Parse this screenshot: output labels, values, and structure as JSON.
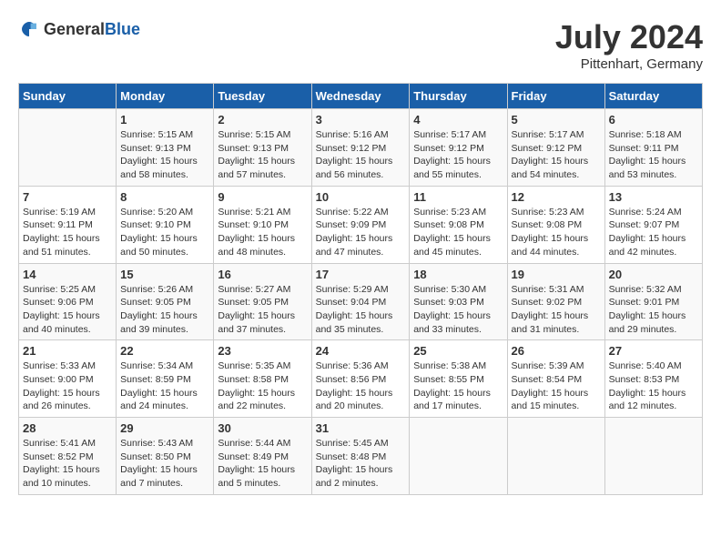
{
  "header": {
    "logo_general": "General",
    "logo_blue": "Blue",
    "month_year": "July 2024",
    "location": "Pittenhart, Germany"
  },
  "days_of_week": [
    "Sunday",
    "Monday",
    "Tuesday",
    "Wednesday",
    "Thursday",
    "Friday",
    "Saturday"
  ],
  "weeks": [
    [
      {
        "day": "",
        "sunrise": "",
        "sunset": "",
        "daylight": ""
      },
      {
        "day": "1",
        "sunrise": "Sunrise: 5:15 AM",
        "sunset": "Sunset: 9:13 PM",
        "daylight": "Daylight: 15 hours and 58 minutes."
      },
      {
        "day": "2",
        "sunrise": "Sunrise: 5:15 AM",
        "sunset": "Sunset: 9:13 PM",
        "daylight": "Daylight: 15 hours and 57 minutes."
      },
      {
        "day": "3",
        "sunrise": "Sunrise: 5:16 AM",
        "sunset": "Sunset: 9:12 PM",
        "daylight": "Daylight: 15 hours and 56 minutes."
      },
      {
        "day": "4",
        "sunrise": "Sunrise: 5:17 AM",
        "sunset": "Sunset: 9:12 PM",
        "daylight": "Daylight: 15 hours and 55 minutes."
      },
      {
        "day": "5",
        "sunrise": "Sunrise: 5:17 AM",
        "sunset": "Sunset: 9:12 PM",
        "daylight": "Daylight: 15 hours and 54 minutes."
      },
      {
        "day": "6",
        "sunrise": "Sunrise: 5:18 AM",
        "sunset": "Sunset: 9:11 PM",
        "daylight": "Daylight: 15 hours and 53 minutes."
      }
    ],
    [
      {
        "day": "7",
        "sunrise": "Sunrise: 5:19 AM",
        "sunset": "Sunset: 9:11 PM",
        "daylight": "Daylight: 15 hours and 51 minutes."
      },
      {
        "day": "8",
        "sunrise": "Sunrise: 5:20 AM",
        "sunset": "Sunset: 9:10 PM",
        "daylight": "Daylight: 15 hours and 50 minutes."
      },
      {
        "day": "9",
        "sunrise": "Sunrise: 5:21 AM",
        "sunset": "Sunset: 9:10 PM",
        "daylight": "Daylight: 15 hours and 48 minutes."
      },
      {
        "day": "10",
        "sunrise": "Sunrise: 5:22 AM",
        "sunset": "Sunset: 9:09 PM",
        "daylight": "Daylight: 15 hours and 47 minutes."
      },
      {
        "day": "11",
        "sunrise": "Sunrise: 5:23 AM",
        "sunset": "Sunset: 9:08 PM",
        "daylight": "Daylight: 15 hours and 45 minutes."
      },
      {
        "day": "12",
        "sunrise": "Sunrise: 5:23 AM",
        "sunset": "Sunset: 9:08 PM",
        "daylight": "Daylight: 15 hours and 44 minutes."
      },
      {
        "day": "13",
        "sunrise": "Sunrise: 5:24 AM",
        "sunset": "Sunset: 9:07 PM",
        "daylight": "Daylight: 15 hours and 42 minutes."
      }
    ],
    [
      {
        "day": "14",
        "sunrise": "Sunrise: 5:25 AM",
        "sunset": "Sunset: 9:06 PM",
        "daylight": "Daylight: 15 hours and 40 minutes."
      },
      {
        "day": "15",
        "sunrise": "Sunrise: 5:26 AM",
        "sunset": "Sunset: 9:05 PM",
        "daylight": "Daylight: 15 hours and 39 minutes."
      },
      {
        "day": "16",
        "sunrise": "Sunrise: 5:27 AM",
        "sunset": "Sunset: 9:05 PM",
        "daylight": "Daylight: 15 hours and 37 minutes."
      },
      {
        "day": "17",
        "sunrise": "Sunrise: 5:29 AM",
        "sunset": "Sunset: 9:04 PM",
        "daylight": "Daylight: 15 hours and 35 minutes."
      },
      {
        "day": "18",
        "sunrise": "Sunrise: 5:30 AM",
        "sunset": "Sunset: 9:03 PM",
        "daylight": "Daylight: 15 hours and 33 minutes."
      },
      {
        "day": "19",
        "sunrise": "Sunrise: 5:31 AM",
        "sunset": "Sunset: 9:02 PM",
        "daylight": "Daylight: 15 hours and 31 minutes."
      },
      {
        "day": "20",
        "sunrise": "Sunrise: 5:32 AM",
        "sunset": "Sunset: 9:01 PM",
        "daylight": "Daylight: 15 hours and 29 minutes."
      }
    ],
    [
      {
        "day": "21",
        "sunrise": "Sunrise: 5:33 AM",
        "sunset": "Sunset: 9:00 PM",
        "daylight": "Daylight: 15 hours and 26 minutes."
      },
      {
        "day": "22",
        "sunrise": "Sunrise: 5:34 AM",
        "sunset": "Sunset: 8:59 PM",
        "daylight": "Daylight: 15 hours and 24 minutes."
      },
      {
        "day": "23",
        "sunrise": "Sunrise: 5:35 AM",
        "sunset": "Sunset: 8:58 PM",
        "daylight": "Daylight: 15 hours and 22 minutes."
      },
      {
        "day": "24",
        "sunrise": "Sunrise: 5:36 AM",
        "sunset": "Sunset: 8:56 PM",
        "daylight": "Daylight: 15 hours and 20 minutes."
      },
      {
        "day": "25",
        "sunrise": "Sunrise: 5:38 AM",
        "sunset": "Sunset: 8:55 PM",
        "daylight": "Daylight: 15 hours and 17 minutes."
      },
      {
        "day": "26",
        "sunrise": "Sunrise: 5:39 AM",
        "sunset": "Sunset: 8:54 PM",
        "daylight": "Daylight: 15 hours and 15 minutes."
      },
      {
        "day": "27",
        "sunrise": "Sunrise: 5:40 AM",
        "sunset": "Sunset: 8:53 PM",
        "daylight": "Daylight: 15 hours and 12 minutes."
      }
    ],
    [
      {
        "day": "28",
        "sunrise": "Sunrise: 5:41 AM",
        "sunset": "Sunset: 8:52 PM",
        "daylight": "Daylight: 15 hours and 10 minutes."
      },
      {
        "day": "29",
        "sunrise": "Sunrise: 5:43 AM",
        "sunset": "Sunset: 8:50 PM",
        "daylight": "Daylight: 15 hours and 7 minutes."
      },
      {
        "day": "30",
        "sunrise": "Sunrise: 5:44 AM",
        "sunset": "Sunset: 8:49 PM",
        "daylight": "Daylight: 15 hours and 5 minutes."
      },
      {
        "day": "31",
        "sunrise": "Sunrise: 5:45 AM",
        "sunset": "Sunset: 8:48 PM",
        "daylight": "Daylight: 15 hours and 2 minutes."
      },
      {
        "day": "",
        "sunrise": "",
        "sunset": "",
        "daylight": ""
      },
      {
        "day": "",
        "sunrise": "",
        "sunset": "",
        "daylight": ""
      },
      {
        "day": "",
        "sunrise": "",
        "sunset": "",
        "daylight": ""
      }
    ]
  ]
}
